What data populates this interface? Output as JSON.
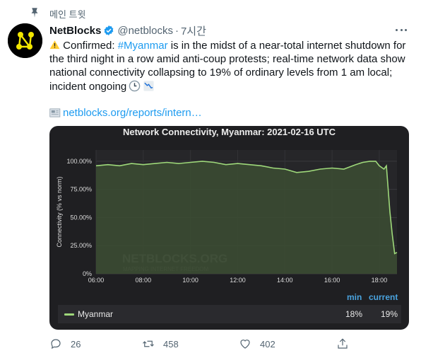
{
  "pinned_label": "메인 트윗",
  "author": {
    "name": "NetBlocks",
    "handle": "@netblocks",
    "time": "7시간"
  },
  "tweet": {
    "text_1": " Confirmed: ",
    "hashtag": "#Myanmar",
    "text_2": " is in the midst of a near-total internet shutdown for the third night in a row amid anti-coup protests; real-time network data show national connectivity collapsing to 19% of ordinary levels from 1 am local; incident ongoing",
    "link": "netblocks.org/reports/intern…"
  },
  "chart_data": {
    "type": "line",
    "title": "Network Connectivity, Myanmar: 2021-02-16 UTC",
    "ylabel": "Connectivity (% vs norm)",
    "xlabel": "",
    "ylim": [
      0,
      110
    ],
    "xlim": [
      6.0,
      18.75
    ],
    "x_ticks": [
      "06:00",
      "08:00",
      "10:00",
      "12:00",
      "14:00",
      "16:00",
      "18:00"
    ],
    "y_ticks": [
      "0%",
      "25.00%",
      "50.00%",
      "75.00%",
      "100.00%"
    ],
    "grid": true,
    "watermark": "NETBLOCKS.ORG",
    "watermark_sub": "MAPPING INTERNET FREEDOM",
    "series": [
      {
        "name": "Myanmar",
        "color": "#9ed87a",
        "x": [
          6.0,
          6.5,
          7.0,
          7.5,
          8.0,
          8.5,
          9.0,
          9.5,
          10.0,
          10.5,
          11.0,
          11.5,
          12.0,
          12.5,
          13.0,
          13.5,
          14.0,
          14.5,
          15.0,
          15.5,
          16.0,
          16.5,
          17.0,
          17.3,
          17.6,
          17.85,
          18.0,
          18.2,
          18.3,
          18.45,
          18.55,
          18.65,
          18.75
        ],
        "y": [
          96,
          97,
          96,
          98,
          97,
          98,
          99,
          98,
          99,
          100,
          99,
          97,
          98,
          97,
          96,
          94,
          93,
          90,
          91,
          93,
          94,
          93,
          97,
          99,
          100,
          100,
          96,
          93,
          96,
          55,
          35,
          18,
          19
        ]
      }
    ],
    "stats": {
      "min_label": "min",
      "current_label": "current",
      "min": "18%",
      "current": "19%"
    }
  },
  "actions": {
    "reply_count": "26",
    "retweet_count": "458",
    "like_count": "402"
  },
  "colors": {
    "accent": "#1d9bf0",
    "card_bg": "#1f1f22",
    "series": "#9ed87a"
  }
}
